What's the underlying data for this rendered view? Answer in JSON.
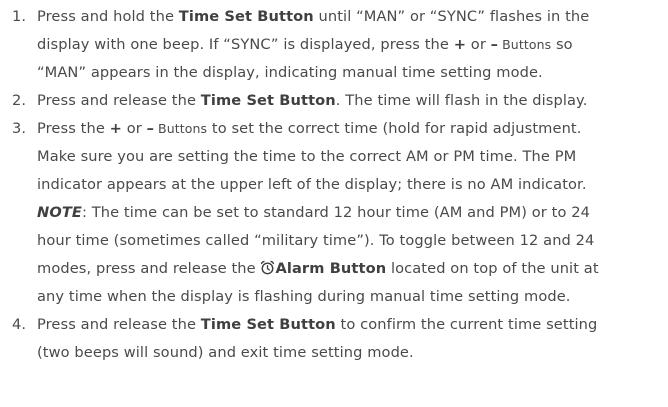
{
  "steps": [
    {
      "num": "1.",
      "l1a": "Press and hold the ",
      "l1b": "Time Set Button",
      "l1c": " until “MAN” or “SYNC” flashes in the",
      "l2a": "display with one beep. If “SYNC” is displayed, press the ",
      "plus": "+",
      "or": " or ",
      "minus": "–",
      "btns": " Buttons",
      "l2b": " so",
      "l3": "“MAN” appears in the display, indicating manual time setting mode."
    },
    {
      "num": "2.",
      "l1a": "Press and release the ",
      "l1b": "Time Set Button",
      "l1c": ". The time will flash in the display."
    },
    {
      "num": "3.",
      "l1a": "Press the ",
      "plus": "+",
      "or": " or ",
      "minus": "–",
      "btns": " Buttons",
      "l1b": " to set the correct time (hold for rapid adjustment.",
      "l2": "Make sure you are setting the time to the correct AM or PM time. The PM",
      "l3": "indicator appears at the upper left of the display; there is no AM indicator.",
      "note": "NOTE",
      "l4": ": The time can be set to standard 12 hour time (AM and PM) or to 24",
      "l5": "hour time (sometimes called “military time”). To toggle between 12 and 24",
      "l6a": "modes, press and release the ",
      "alarm": "Alarm Button",
      "l6b": " located on top of the unit at",
      "l7": "any time when the display is flashing during manual time setting mode."
    },
    {
      "num": "4.",
      "l1a": "Press and release the ",
      "l1b": "Time Set Button",
      "l1c": " to confirm the current time setting",
      "l2": "(two beeps will sound) and exit time setting mode."
    }
  ]
}
